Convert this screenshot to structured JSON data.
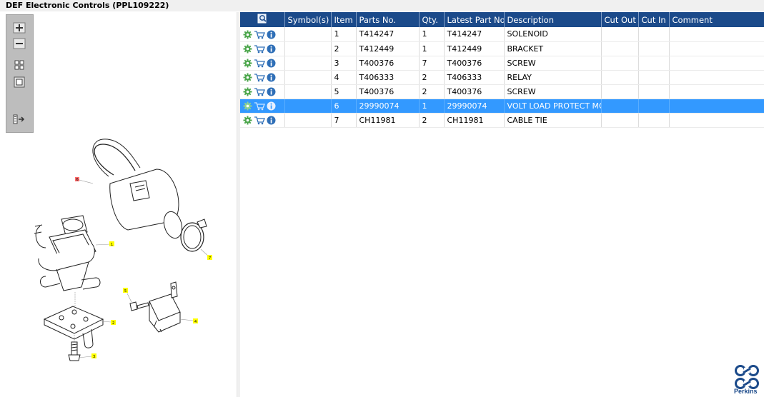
{
  "window": {
    "title": "DEF Electronic Controls (PPL109222)"
  },
  "toolbar": {
    "buttons": [
      {
        "name": "zoom-in-button",
        "icon": "zoom-in-icon"
      },
      {
        "name": "zoom-out-button",
        "icon": "zoom-out-icon"
      },
      {
        "name": "fit-all-button",
        "icon": "fit-icon"
      },
      {
        "name": "actual-size-button",
        "icon": "actual-size-icon"
      },
      {
        "name": "export-button",
        "icon": "export-icon"
      }
    ]
  },
  "diagram": {
    "callouts": [
      "1",
      "2",
      "3",
      "4",
      "5",
      "6",
      "7"
    ]
  },
  "table": {
    "columns": [
      "",
      "Symbol(s)",
      "Item",
      "Parts No.",
      "Qty.",
      "Latest Part No.",
      "Description",
      "Cut Out",
      "Cut In",
      "Comment"
    ],
    "rows": [
      {
        "symbols": "",
        "item": "1",
        "part_no": "T414247",
        "qty": "1",
        "latest": "T414247",
        "description": "SOLENOID",
        "cut_out": "",
        "cut_in": "",
        "comment": ""
      },
      {
        "symbols": "",
        "item": "2",
        "part_no": "T412449",
        "qty": "1",
        "latest": "T412449",
        "description": "BRACKET",
        "cut_out": "",
        "cut_in": "",
        "comment": ""
      },
      {
        "symbols": "",
        "item": "3",
        "part_no": "T400376",
        "qty": "7",
        "latest": "T400376",
        "description": "SCREW",
        "cut_out": "",
        "cut_in": "",
        "comment": ""
      },
      {
        "symbols": "",
        "item": "4",
        "part_no": "T406333",
        "qty": "2",
        "latest": "T406333",
        "description": "RELAY",
        "cut_out": "",
        "cut_in": "",
        "comment": ""
      },
      {
        "symbols": "",
        "item": "5",
        "part_no": "T400376",
        "qty": "2",
        "latest": "T400376",
        "description": "SCREW",
        "cut_out": "",
        "cut_in": "",
        "comment": ""
      },
      {
        "symbols": "",
        "item": "6",
        "part_no": "29990074",
        "qty": "1",
        "latest": "29990074",
        "description": "VOLT LOAD PROTECT MODULE",
        "cut_out": "",
        "cut_in": "",
        "comment": "",
        "selected": true
      },
      {
        "symbols": "",
        "item": "7",
        "part_no": "CH11981",
        "qty": "2",
        "latest": "CH11981",
        "description": "CABLE TIE",
        "cut_out": "",
        "cut_in": "",
        "comment": ""
      }
    ],
    "row_icons": [
      "gear-icon",
      "cart-icon",
      "info-icon"
    ]
  },
  "brand": {
    "name": "Perkins",
    "color": "#1b4a8a"
  },
  "colors": {
    "header_bg": "#1b4a8a",
    "selected_row": "#3399ff"
  }
}
